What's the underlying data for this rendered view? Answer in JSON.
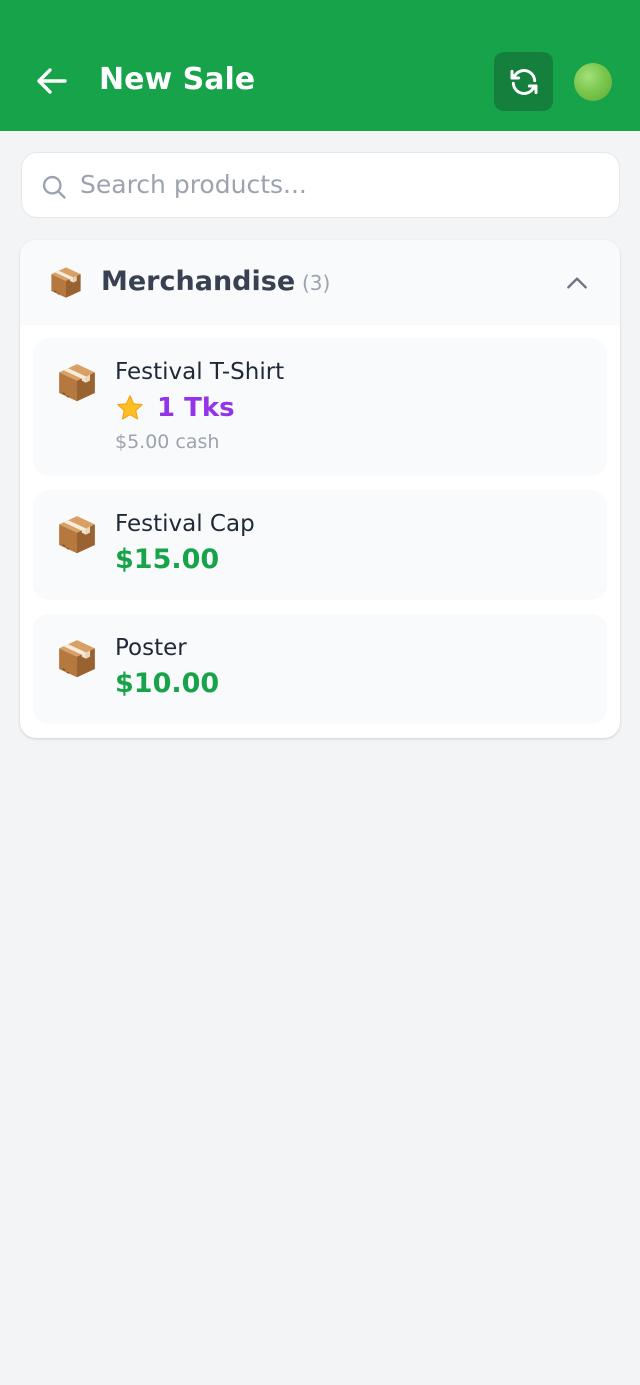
{
  "header": {
    "title": "New Sale",
    "back_icon": "arrow-left-icon",
    "sync_icon": "refresh-icon",
    "status_icon": "online-status-dot",
    "colors": {
      "background": "#16a34a",
      "sync_button": "#15803d",
      "status": "#7cc84e"
    }
  },
  "search": {
    "placeholder": "Search products...",
    "value": "",
    "icon": "search-icon"
  },
  "category": {
    "icon": "package-icon",
    "name": "Merchandise",
    "count": "(3)",
    "expanded": true,
    "toggle_icon": "chevron-up-icon",
    "products": [
      {
        "icon": "package-icon",
        "name": "Festival T-Shirt",
        "token_icon": "star-icon",
        "token_price": "1 Tks",
        "cash_price": "$5.00 cash"
      },
      {
        "icon": "package-icon",
        "name": "Festival Cap",
        "price": "$15.00"
      },
      {
        "icon": "package-icon",
        "name": "Poster",
        "price": "$10.00"
      }
    ]
  },
  "colors": {
    "price_green": "#16a34a",
    "token_purple": "#9333ea",
    "background": "#f3f4f6"
  }
}
